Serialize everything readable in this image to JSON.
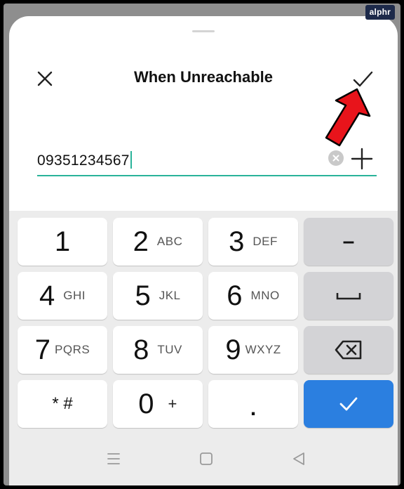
{
  "watermark": "alphr",
  "header": {
    "title": "When Unreachable",
    "close_icon": "close-icon",
    "confirm_icon": "checkmark-icon"
  },
  "input": {
    "value": "09351234567",
    "clear_icon": "clear-circle-icon",
    "add_icon": "plus-icon"
  },
  "keypad": {
    "rows": [
      [
        {
          "digit": "1",
          "letters": ""
        },
        {
          "digit": "2",
          "letters": "ABC"
        },
        {
          "digit": "3",
          "letters": "DEF"
        },
        {
          "fn": "–",
          "icon": "dash-icon"
        }
      ],
      [
        {
          "digit": "4",
          "letters": "GHI"
        },
        {
          "digit": "5",
          "letters": "JKL"
        },
        {
          "digit": "6",
          "letters": "MNO"
        },
        {
          "fn": "",
          "icon": "space-icon"
        }
      ],
      [
        {
          "digit": "7",
          "letters": "PQRS"
        },
        {
          "digit": "8",
          "letters": "TUV"
        },
        {
          "digit": "9",
          "letters": "WXYZ"
        },
        {
          "fn": "",
          "icon": "backspace-icon"
        }
      ],
      [
        {
          "digit": "* #",
          "letters": ""
        },
        {
          "digit": "0",
          "letters": "+"
        },
        {
          "digit": ".",
          "letters": ""
        },
        {
          "fn": "",
          "icon": "checkmark-icon"
        }
      ]
    ]
  },
  "navbar": {
    "icons": [
      "menu-icon",
      "home-icon",
      "back-icon"
    ]
  },
  "colors": {
    "accent": "#2ab39a",
    "confirm_key": "#2b7fe0",
    "arrow": "#e8141b"
  }
}
